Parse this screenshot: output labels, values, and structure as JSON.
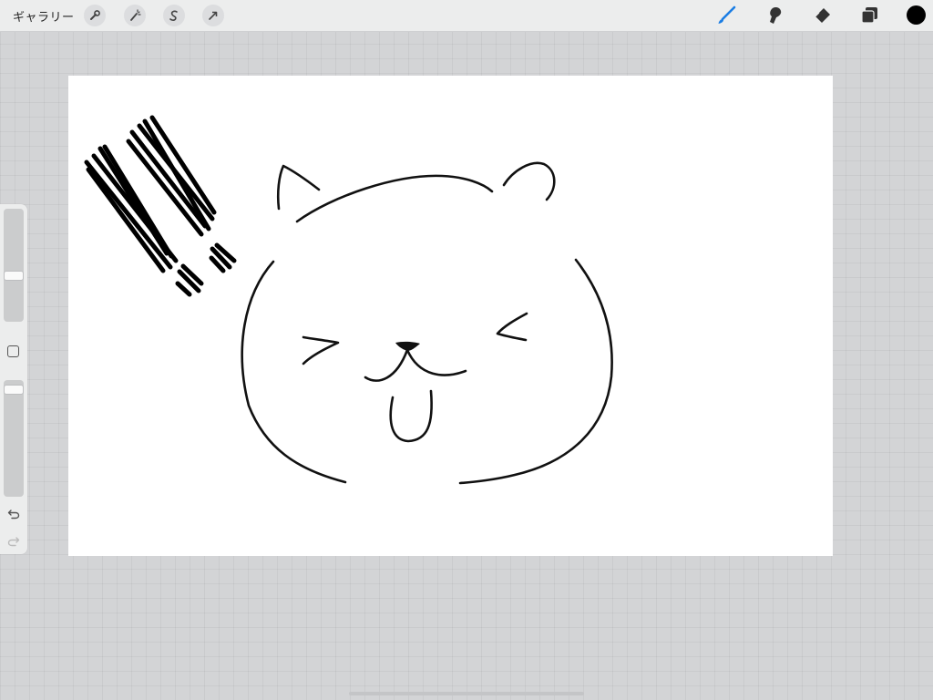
{
  "toolbar": {
    "gallery_label": "ギャラリー",
    "left_tools": [
      "wrench-icon",
      "magic-wand-icon",
      "selection-s-icon",
      "transform-arrow-icon"
    ],
    "right_tools": [
      "brush-icon",
      "smudge-icon",
      "eraser-icon",
      "layers-icon"
    ],
    "active_tool": "brush-icon",
    "active_color": "#000000",
    "accent_color": "#1a7de4"
  },
  "sidebar": {
    "brush_size_level": 0.4,
    "opacity_level": 0.96,
    "buttons": [
      "modify-square-icon",
      "undo-icon",
      "redo-icon"
    ]
  },
  "canvas": {
    "background": "#ffffff",
    "drawing": "cat-face-with-exclamation-marks"
  }
}
